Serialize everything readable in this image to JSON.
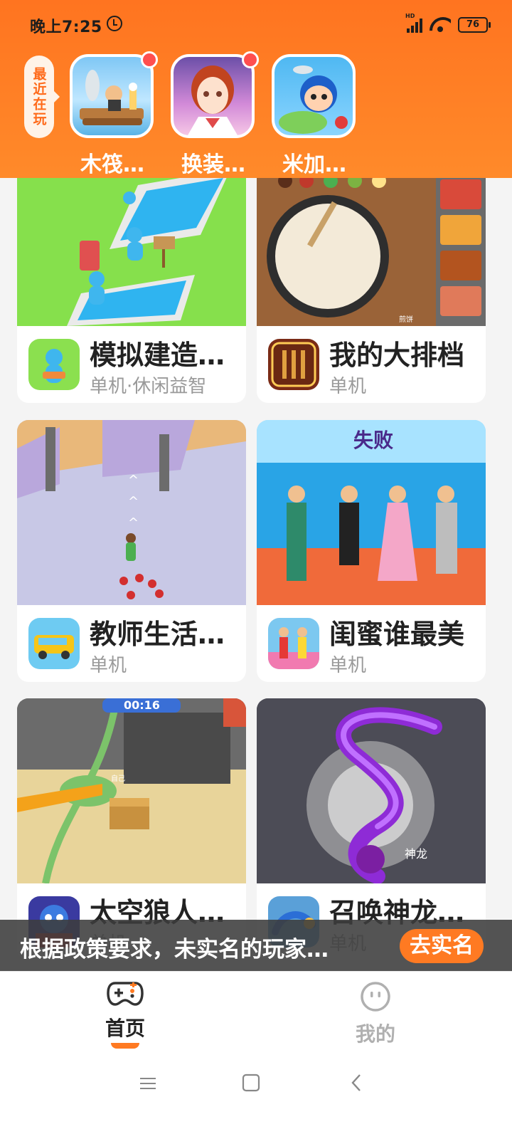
{
  "status_bar": {
    "time": "晚上7:25",
    "network": "HD",
    "battery": "76"
  },
  "recent": {
    "tag_label": "最近在玩",
    "items": [
      {
        "label": "木筏…",
        "has_badge": true
      },
      {
        "label": "换装…",
        "has_badge": true
      },
      {
        "label": "米加…",
        "has_badge": false
      }
    ]
  },
  "games": [
    {
      "title": "模拟建造…",
      "subtitle": "单机·休闲益智"
    },
    {
      "title": "我的大排档",
      "subtitle": "单机"
    },
    {
      "title": "教师生活…",
      "subtitle": "单机"
    },
    {
      "title": "闺蜜谁最美",
      "subtitle": "单机"
    },
    {
      "title": "太空狼人…",
      "subtitle": "单机"
    },
    {
      "title": "召唤神龙…",
      "subtitle": "单机"
    }
  ],
  "game_art_text": {
    "beauty_fail": "失败",
    "pancake_label": "煎饼",
    "werewolf_timer": "00:16",
    "werewolf_self": "自己",
    "dragon_label": "神龙"
  },
  "banner": {
    "text": "根据政策要求，未实名的玩家…",
    "button": "去实名"
  },
  "bottom_nav": {
    "home": "首页",
    "mine": "我的"
  },
  "colors": {
    "accent": "#ff7a22",
    "header": "#ff7420"
  },
  "icons": [
    "alarm-icon",
    "signal-icon",
    "wifi-icon",
    "battery-icon",
    "gamepad-icon",
    "smiley-icon",
    "menu-icon",
    "home-square-icon",
    "back-icon"
  ]
}
